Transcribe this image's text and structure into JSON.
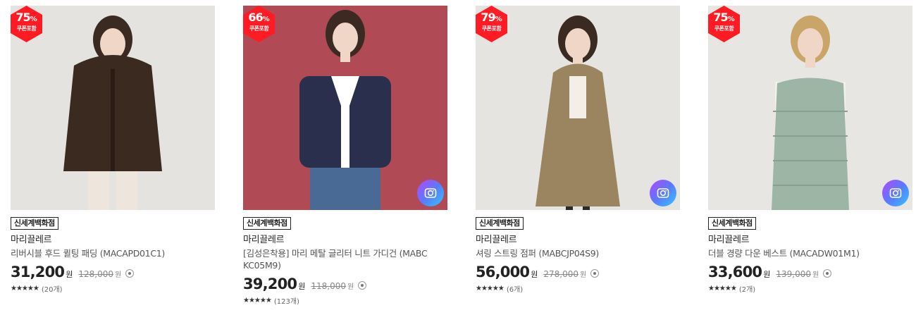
{
  "products": [
    {
      "discount": "75",
      "discount_unit": "%",
      "coupon_label": "쿠폰포함",
      "store": "신세계백화점",
      "brand": "마리끌레르",
      "name": "리버시블 후드 퀼팅 패딩 (MACAPD01C1)",
      "price": "31,200",
      "currency": "원",
      "original_price": "128,000",
      "stars": "★★★★★",
      "review_count": "(20개)",
      "has_camera": false,
      "bg_color": "#e5e3e0",
      "garment_color": "#3a2a20"
    },
    {
      "discount": "66",
      "discount_unit": "%",
      "coupon_label": "쿠폰포함",
      "store": "신세계백화점",
      "brand": "마리끌레르",
      "name": "[김성은착용] 마리 메탈 글리터 니트 가디건 (MABCKC05M9)",
      "price": "39,200",
      "currency": "원",
      "original_price": "118,000",
      "stars": "★★★★★",
      "review_count": "(123개)",
      "has_camera": true,
      "bg_color": "#b04a55",
      "garment_color": "#2a2f4e"
    },
    {
      "discount": "79",
      "discount_unit": "%",
      "coupon_label": "쿠폰포함",
      "store": "신세계백화점",
      "brand": "마리끌레르",
      "name": "셔링 스트링 점퍼 (MABCJP04S9)",
      "price": "56,000",
      "currency": "원",
      "original_price": "278,000",
      "stars": "★★★★★",
      "review_count": "(6개)",
      "has_camera": true,
      "bg_color": "#e6e4e1",
      "garment_color": "#9a8560"
    },
    {
      "discount": "75",
      "discount_unit": "%",
      "coupon_label": "쿠폰포함",
      "store": "신세계백화점",
      "brand": "마리끌레르",
      "name": "더블 경량 다운 베스트 (MACADW01M1)",
      "price": "33,600",
      "currency": "원",
      "original_price": "139,000",
      "stars": "★★★★★",
      "review_count": "(2개)",
      "has_camera": true,
      "bg_color": "#e8e6e2",
      "garment_color": "#9cb5a4"
    }
  ]
}
